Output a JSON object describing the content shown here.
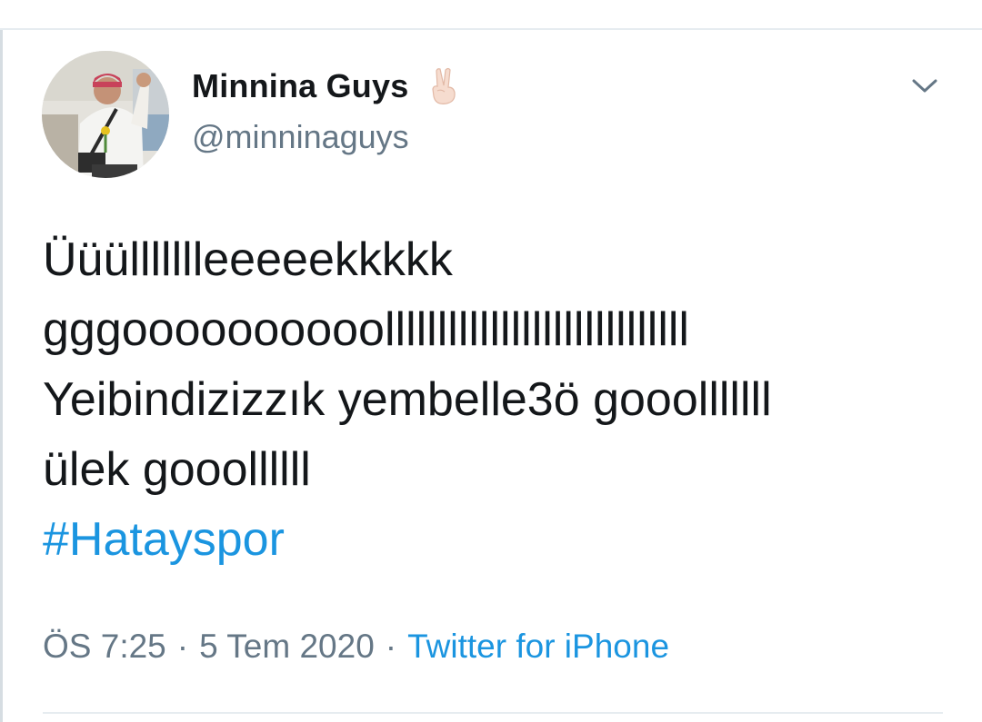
{
  "author": {
    "display_name": "Minnina Guys",
    "handle": "@minninaguys",
    "name_emoji_icon": "victory-hand-emoji-icon"
  },
  "tweet": {
    "lines": [
      "Üüüllllllleeeeekkkkk",
      "gggoooooooooolllllllllllllllllllllllllllll",
      "Yeibindizizzık yembelle3ö gooolllllll",
      "ülek gooollllll"
    ],
    "hashtag": "#Hatayspor"
  },
  "meta": {
    "time": "ÖS 7:25",
    "date": "5 Tem 2020",
    "separator": "·",
    "source": "Twitter for iPhone"
  },
  "colors": {
    "text": "#14171a",
    "secondary": "#657786",
    "link": "#1b95e0",
    "divider": "#e6ecf0"
  },
  "icons": {
    "menu": "chevron-down-icon"
  }
}
